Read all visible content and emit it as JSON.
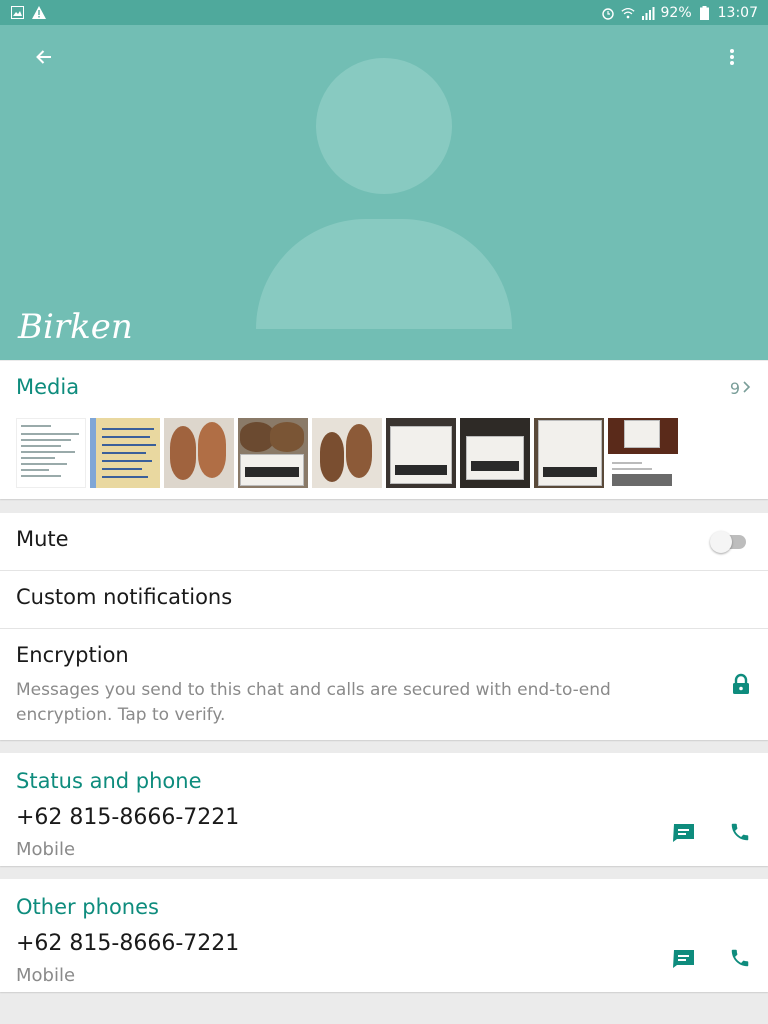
{
  "status_bar": {
    "battery": "92%",
    "time": "13:07",
    "icons_left": [
      "image-icon",
      "warning-icon"
    ],
    "icons_right": [
      "alarm-icon",
      "wifi-icon",
      "signal-icon",
      "battery-icon"
    ]
  },
  "contact": {
    "name": "Birken"
  },
  "media": {
    "title": "Media",
    "count": "9",
    "thumbnails": [
      "document",
      "handwritten-note",
      "sandals",
      "sandals-box",
      "sandals",
      "birkenstock-box",
      "birkenstock-box",
      "birkenstock-box",
      "screenshot"
    ]
  },
  "settings": {
    "mute_label": "Mute",
    "mute_on": false,
    "custom_notifications_label": "Custom notifications",
    "encryption_label": "Encryption",
    "encryption_desc": "Messages you send to this chat and calls are secured with end-to-end encryption. Tap to verify."
  },
  "status_phone": {
    "title": "Status and phone",
    "number": "+62 815-8666-7221",
    "type": "Mobile"
  },
  "other_phones": {
    "title": "Other phones",
    "number": "+62 815-8666-7221",
    "type": "Mobile"
  },
  "colors": {
    "header": "#72beb4",
    "status_bar": "#4fa99c",
    "accent": "#0e8c7d"
  }
}
